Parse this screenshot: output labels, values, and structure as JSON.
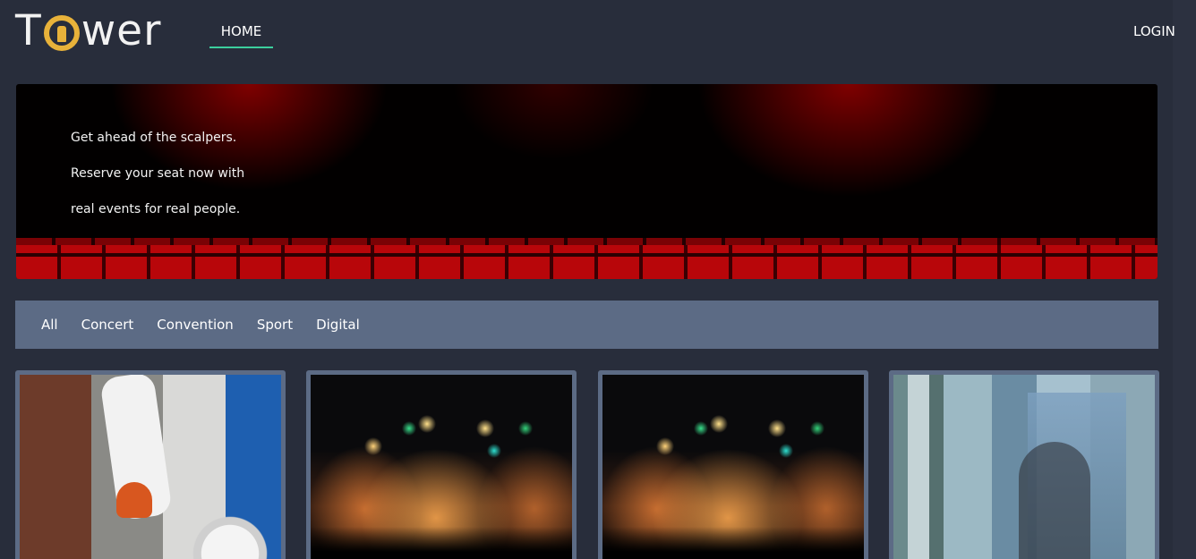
{
  "header": {
    "logo_text": "Tower",
    "nav_home": "HOME",
    "nav_login": "LOGIN"
  },
  "hero": {
    "lines": [
      "Get ahead of the scalpers.",
      "Reserve your seat now with",
      "real events for real people."
    ]
  },
  "filters": {
    "tabs": [
      "All",
      "Concert",
      "Convention",
      "Sport",
      "Digital"
    ]
  },
  "cards": [
    {
      "image": "soccer-player-photo"
    },
    {
      "image": "concert-stage-photo"
    },
    {
      "image": "concert-stage-photo"
    },
    {
      "image": "city-window-reflection-photo"
    }
  ],
  "colors": {
    "background": "#282d3b",
    "filter_bar": "#5c6b85",
    "nav_underline": "#3ccf9e",
    "logo_accent": "#e8b23a"
  }
}
